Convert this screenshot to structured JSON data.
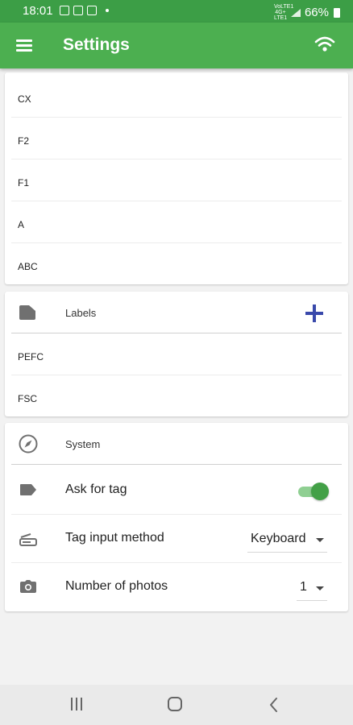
{
  "status_bar": {
    "time": "18:01",
    "network": "VoLTE1 4G+ LTE1",
    "battery": "66%"
  },
  "app_bar": {
    "title": "Settings"
  },
  "list1": {
    "items": [
      "CX",
      "F2",
      "F1",
      "A",
      "ABC"
    ]
  },
  "labels_section": {
    "title": "Labels",
    "items": [
      "PEFC",
      "FSC"
    ]
  },
  "system_section": {
    "title": "System",
    "ask_for_tag": {
      "label": "Ask for tag",
      "enabled": true
    },
    "tag_input_method": {
      "label": "Tag input method",
      "value": "Keyboard"
    },
    "number_of_photos": {
      "label": "Number of photos",
      "value": "1"
    }
  },
  "colors": {
    "primary": "#4caf50",
    "status_bar": "#3c9e46",
    "accent": "#3949ab",
    "toggle_thumb": "#43a047",
    "toggle_track": "#8fcf92"
  },
  "icons": {
    "app_bar": [
      "menu-icon",
      "wifi-icon"
    ],
    "labels_header": "folder-icon",
    "labels_add": "add-icon",
    "system_header": "compass-icon",
    "ask_for_tag": "label-tag-icon",
    "tag_input_method": "scanner-icon",
    "number_of_photos": "camera-icon"
  }
}
